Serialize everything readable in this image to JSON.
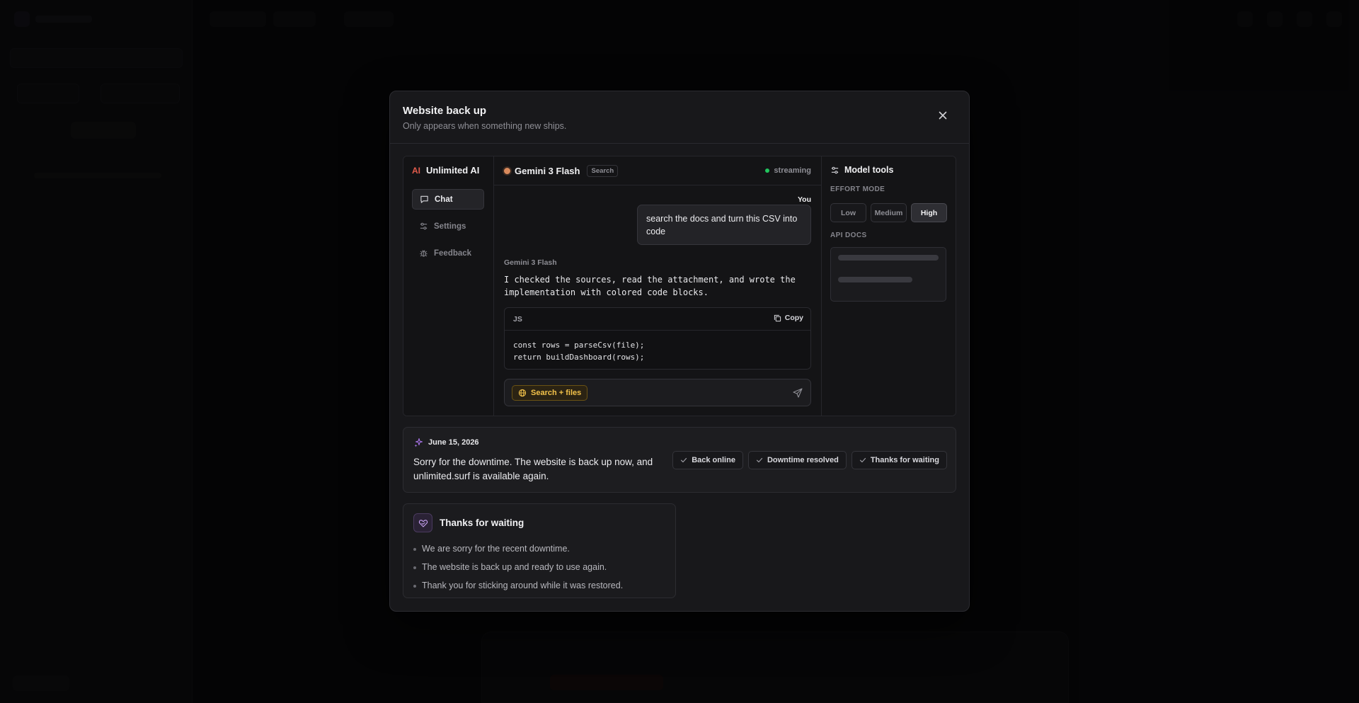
{
  "colors": {
    "accent_amber": "#f3c24a",
    "status_green": "#22c55e",
    "brand_red": "#e25b4b",
    "update_purple": "#a874e8"
  },
  "modal": {
    "title": "Website back up",
    "subtitle": "Only appears when something new ships.",
    "close_icon": "close-icon"
  },
  "preview": {
    "brand": {
      "mark": "AI",
      "name": "Unlimited AI"
    },
    "nav": [
      {
        "label": "Chat",
        "icon": "chat-icon",
        "active": true
      },
      {
        "label": "Settings",
        "icon": "sliders-icon",
        "active": false
      },
      {
        "label": "Feedback",
        "icon": "bug-icon",
        "active": false
      }
    ],
    "model": {
      "name": "Gemini 3 Flash",
      "tag": "Search"
    },
    "status": "streaming",
    "messages": {
      "user_label": "You",
      "user_text": "search the docs and turn this CSV into code",
      "bot_label": "Gemini 3 Flash",
      "bot_text": "I checked the sources, read the attachment, and wrote the implementation with colored code blocks."
    },
    "code": {
      "lang": "JS",
      "copy_label": "Copy",
      "lines": [
        "const rows = parseCsv(file);",
        "return buildDashboard(rows);"
      ]
    },
    "composer": {
      "chip": "Search + files",
      "send_icon": "send-icon"
    },
    "tools": {
      "title": "Model tools",
      "effort_label": "EFFORT MODE",
      "effort_options": [
        "Low",
        "Medium",
        "High"
      ],
      "effort_selected": "High",
      "docs_label": "API DOCS"
    }
  },
  "update": {
    "date": "June 15, 2026",
    "text": "Sorry for the downtime. The website is back up now, and unlimited.surf is available again.",
    "badges": [
      "Back online",
      "Downtime resolved",
      "Thanks for waiting"
    ]
  },
  "thanks": {
    "title": "Thanks for waiting",
    "items": [
      "We are sorry for the recent downtime.",
      "The website is back up and ready to use again.",
      "Thank you for sticking around while it was restored."
    ]
  }
}
